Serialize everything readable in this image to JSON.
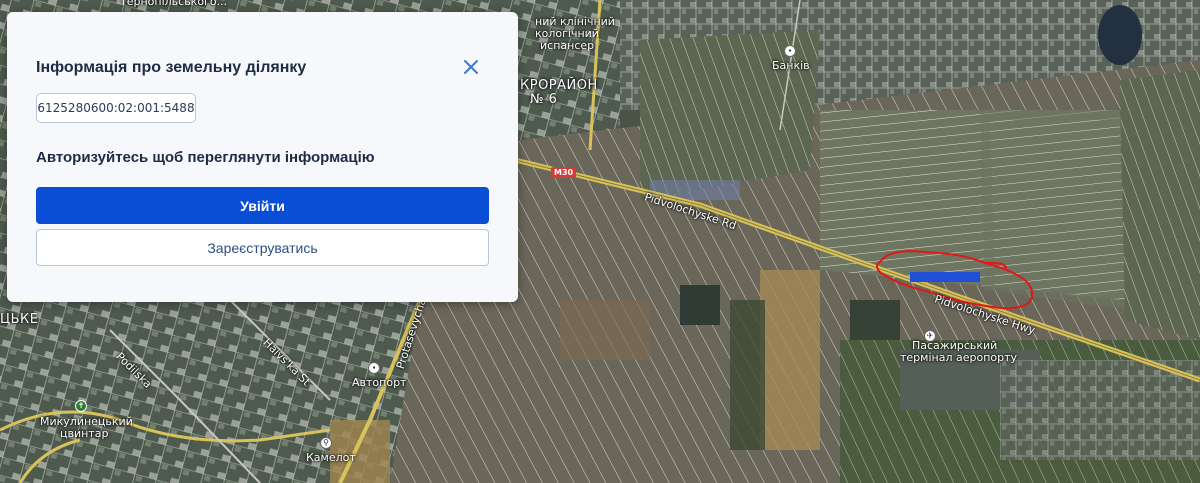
{
  "panel": {
    "title": "Інформація про земельну ділянку",
    "cadastral_number": "6125280600:02:001:5488",
    "auth_prompt": "Авторизуйтесь щоб переглянути інформацію",
    "login_label": "Увійти",
    "register_label": "Зареєструватись"
  },
  "map": {
    "labels": {
      "clinic_line1": "ний клінічний",
      "clinic_line2": "кологічний",
      "clinic_line3": "испансер",
      "top_fragment": "Тернопільського...",
      "microdistrict_line1": "КРОРАЙОН",
      "microdistrict_line2": "№ 6",
      "bankiv": "Банків",
      "route_shield": "М30",
      "pidvolochyske_rd": "Pidvolochyske Rd",
      "pidvolochyske_hwy": "Pidvolochyske Hwy",
      "terminal_line1": "Пасажирський",
      "terminal_line2": "термінал аеропорту",
      "avtoport": "Автопорт",
      "protasevycha": "Protasevycha",
      "podilska": "Podilska",
      "haivska": "Haivs'ka St",
      "mykulyntsky_line1": "Микулинецький",
      "mykulyntsky_line2": "цвинтар",
      "kamelot": "Камелот",
      "left_edge": "ЦЬКЕ"
    },
    "colors": {
      "parcel_highlight": "#2050d8",
      "annotation_circle": "#e01818",
      "road": "#d8c25a"
    }
  }
}
